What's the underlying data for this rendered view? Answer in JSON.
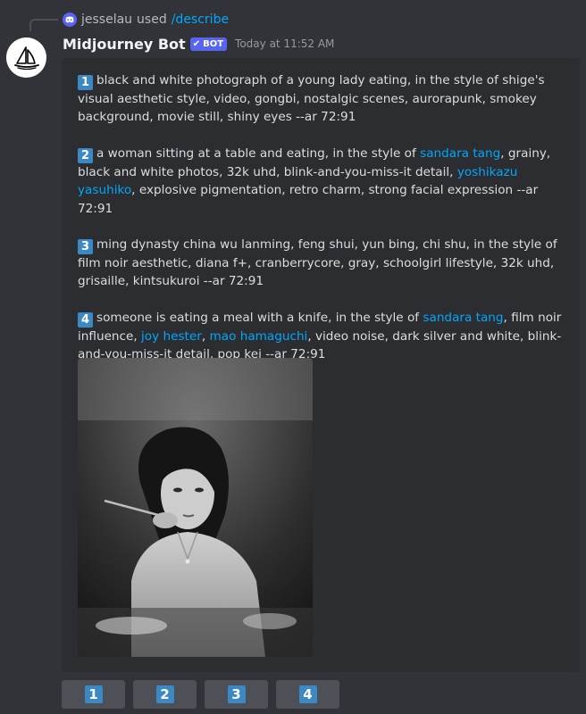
{
  "reply": {
    "username": "jesselau",
    "action": "used",
    "command": "/describe"
  },
  "message": {
    "author": "Midjourney Bot",
    "badge": "BOT",
    "timestamp": "Today at 11:52 AM"
  },
  "prompts": [
    {
      "number": "1",
      "segments": [
        {
          "text": "black and white photograph of a young lady eating, in the style of shige's visual aesthetic style, video, gongbi, nostalgic scenes, aurorapunk, smokey background, movie still, shiny eyes --ar 72:91",
          "link": false
        }
      ]
    },
    {
      "number": "2",
      "segments": [
        {
          "text": "a woman sitting at a table and eating, in the style of ",
          "link": false
        },
        {
          "text": "sandara tang",
          "link": true
        },
        {
          "text": ", grainy, black and white photos, 32k uhd, blink-and-you-miss-it detail, ",
          "link": false
        },
        {
          "text": "yoshikazu yasuhiko",
          "link": true
        },
        {
          "text": ", explosive pigmentation, retro charm, strong facial expression --ar 72:91",
          "link": false
        }
      ]
    },
    {
      "number": "3",
      "segments": [
        {
          "text": "ming dynasty china wu lanming, feng shui, yun bing, chi shu, in the style of film noir aesthetic, diana f+, cranberrycore, gray, schoolgirl lifestyle, 32k uhd, grisaille, kintsukuroi --ar 72:91",
          "link": false
        }
      ]
    },
    {
      "number": "4",
      "segments": [
        {
          "text": "someone is eating a meal with a knife, in the style of ",
          "link": false
        },
        {
          "text": "sandara tang",
          "link": true
        },
        {
          "text": ", film noir influence, ",
          "link": false
        },
        {
          "text": "joy hester",
          "link": true
        },
        {
          "text": ", ",
          "link": false
        },
        {
          "text": "mao hamaguchi",
          "link": true
        },
        {
          "text": ", video noise, dark silver and white, blink-and-you-miss-it detail, pop kei --ar 72:91",
          "link": false
        }
      ]
    }
  ],
  "buttons": [
    {
      "label": "1"
    },
    {
      "label": "2"
    },
    {
      "label": "3"
    },
    {
      "label": "4"
    }
  ],
  "colors": {
    "background": "#313338",
    "embed": "#2b2d31",
    "link": "#00a8fc",
    "badge": "#5865f2",
    "number_box": "#3b88c3",
    "button": "#4e5058"
  },
  "icons": {
    "reply_avatar": "discord-logo-icon",
    "bot_avatar": "midjourney-boat-icon",
    "badge_check": "checkmark-icon"
  }
}
